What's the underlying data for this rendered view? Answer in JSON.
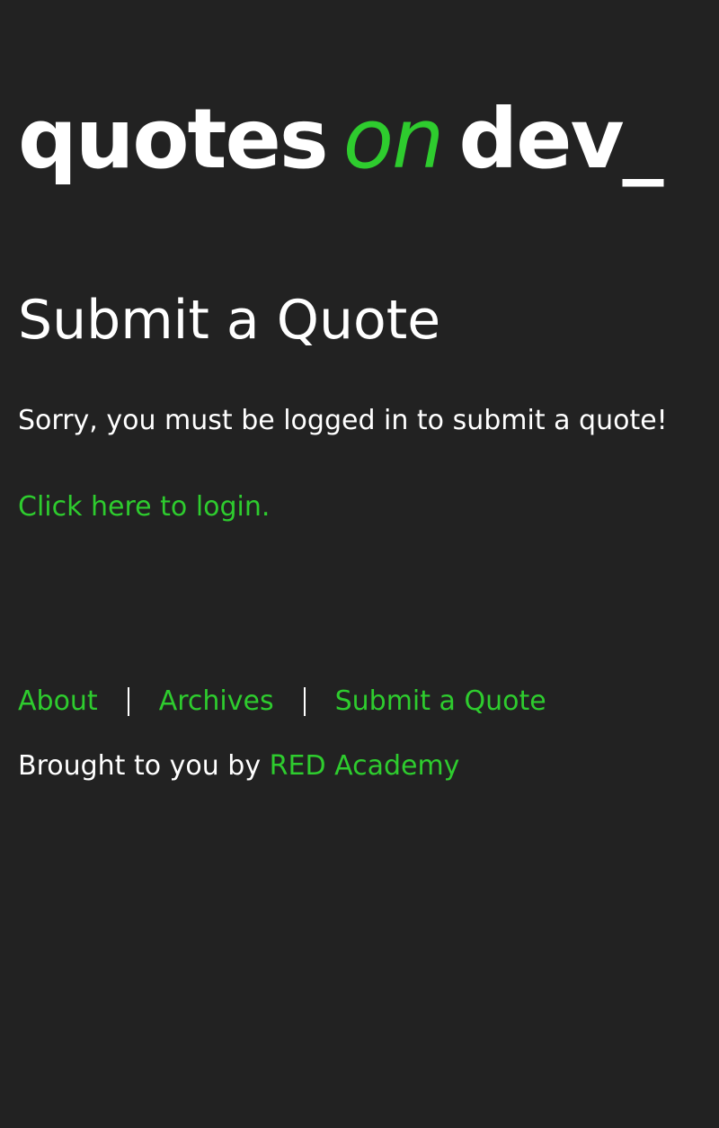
{
  "site": {
    "logo": {
      "word1": "quotes",
      "word2": "on",
      "word3": "dev_"
    },
    "accent_color": "#2ecc2e",
    "background_color": "#222222",
    "text_color": "#ffffff"
  },
  "main": {
    "title": "Submit a Quote",
    "message": "Sorry, you must be logged in to submit a quote!",
    "login_link": "Click here to login."
  },
  "footer": {
    "nav": [
      "About",
      "Archives",
      "Submit a Quote"
    ],
    "separator": "|",
    "credit_prefix": "Brought to you by",
    "credit_link": "RED Academy"
  }
}
